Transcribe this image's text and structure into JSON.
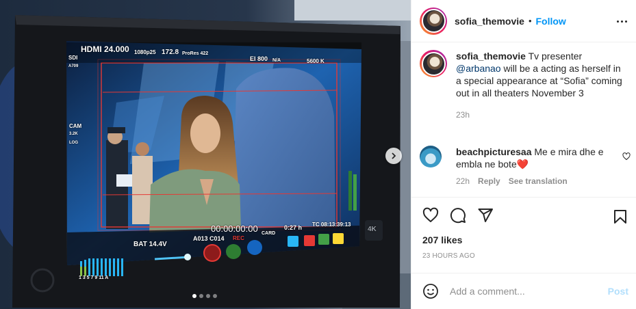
{
  "post": {
    "username": "sofia_themovie",
    "follow_label": "Follow",
    "separator": "•",
    "caption_prefix": "Tv presenter",
    "mention": "@arbanao",
    "caption_suffix": "will be a acting as herself in a special appearance at “Sofia” coming out in all theaters November 3",
    "caption_time": "23h",
    "likes": "207 likes",
    "posted_ago": "23 HOURS AGO"
  },
  "comments": [
    {
      "username": "beachpicturesaa",
      "text": "Me e mira dhe e embla ne bote",
      "emoji": "❤️",
      "time": "22h",
      "reply_label": "Reply",
      "translate_label": "See translation"
    }
  ],
  "add_comment": {
    "placeholder": "Add a comment...",
    "post_label": "Post"
  },
  "monitor": {
    "hdmi_fps": "HDMI 24.000",
    "rec_format": "1080p25",
    "shutter": "172.8",
    "codec": "ProRes 422",
    "iso": "EI 800",
    "nd": "N/A",
    "wb": "5600 K",
    "sdi": "SDI",
    "a709": "A709",
    "cam": "CAM",
    "cam_res": "3.2K",
    "cam_log": "LOG",
    "bat": "BAT 14.4V",
    "timecode": "00:00:00:00",
    "clip": "A013 C014",
    "rec": "REC",
    "card": "CARD",
    "remaining": "0:27 h",
    "tc": "TC 08:13:39:13",
    "audio_channels": "1 3 5 7 9 11 A",
    "brand": "4K"
  },
  "carousel": {
    "slides": 4,
    "active_index": 0
  },
  "colors": {
    "accent": "#0095f6",
    "mention": "#00376b",
    "muted": "#8e8e8e",
    "post_disabled": "#b2dffc",
    "rec_red": "#e53935"
  }
}
